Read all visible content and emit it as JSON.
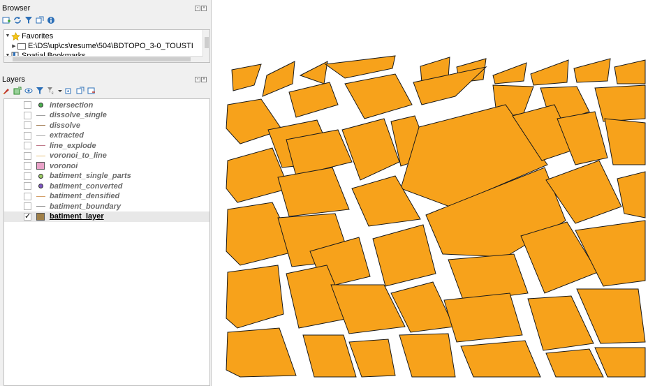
{
  "browser": {
    "title": "Browser",
    "tree": [
      {
        "label": "Favorites"
      },
      {
        "label": "E:\\DS\\up\\cs\\resume\\504\\BDTOPO_3-0_TOUSTI"
      },
      {
        "label": "Spatial Bookmarks"
      }
    ]
  },
  "layers": {
    "title": "Layers",
    "items": [
      {
        "name": "intersection",
        "checked": false,
        "symbol": "point",
        "color": "#4caf50"
      },
      {
        "name": "dissolve_single",
        "checked": false,
        "symbol": "line",
        "color": "#a0a0a0"
      },
      {
        "name": "dissolve",
        "checked": false,
        "symbol": "line",
        "color": "#a07a50"
      },
      {
        "name": "extracted",
        "checked": false,
        "symbol": "line",
        "color": "#b0b0b0"
      },
      {
        "name": "line_explode",
        "checked": false,
        "symbol": "line",
        "color": "#c07a8a"
      },
      {
        "name": "voronoi_to_line",
        "checked": false,
        "symbol": "line",
        "color": "#e6c27a"
      },
      {
        "name": "voronoi",
        "checked": false,
        "symbol": "fill",
        "color": "#e9a2c8"
      },
      {
        "name": "batiment_single_parts",
        "checked": false,
        "symbol": "point",
        "color": "#9ccc65"
      },
      {
        "name": "batiment_converted",
        "checked": false,
        "symbol": "point",
        "color": "#7e57c2"
      },
      {
        "name": "batiment_densified",
        "checked": false,
        "symbol": "line",
        "color": "#d4a06a"
      },
      {
        "name": "batiment_boundary",
        "checked": false,
        "symbol": "line",
        "color": "#8a8a8a"
      },
      {
        "name": "batiment_layer",
        "checked": true,
        "symbol": "fill",
        "color": "#a08048"
      }
    ]
  },
  "map": {
    "fill_color": "#f7a21b",
    "stroke_color": "#1a1a1a"
  }
}
